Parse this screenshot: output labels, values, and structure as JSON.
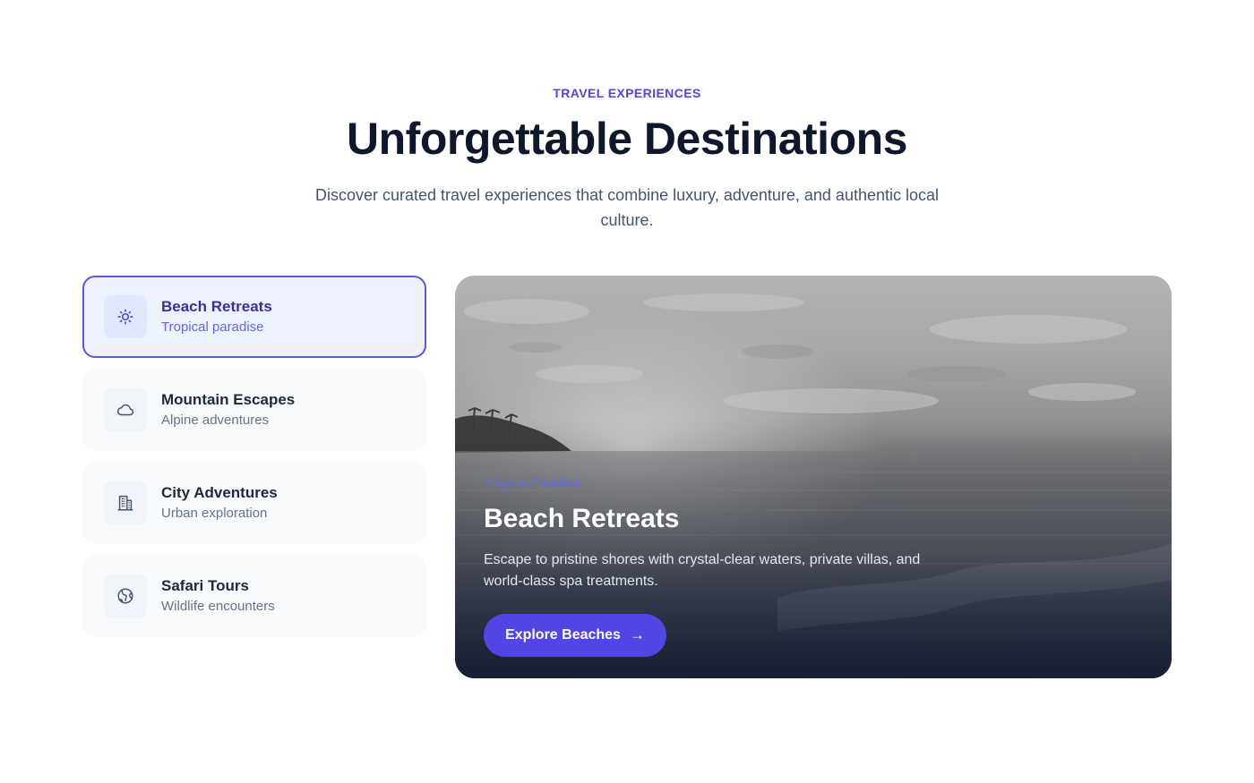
{
  "header": {
    "eyebrow": "TRAVEL EXPERIENCES",
    "title": "Unforgettable Destinations",
    "subtitle": "Discover curated travel experiences that combine luxury, adventure, and authentic local culture."
  },
  "tabs": [
    {
      "title": "Beach Retreats",
      "subtitle": "Tropical paradise",
      "icon": "sun-icon",
      "active": true
    },
    {
      "title": "Mountain Escapes",
      "subtitle": "Alpine adventures",
      "icon": "cloud-icon",
      "active": false
    },
    {
      "title": "City Adventures",
      "subtitle": "Urban exploration",
      "icon": "building-icon",
      "active": false
    },
    {
      "title": "Safari Tours",
      "subtitle": "Wildlife encounters",
      "icon": "globe-icon",
      "active": false
    }
  ],
  "feature": {
    "eyebrow": "Tropical Paradise",
    "title": "Beach Retreats",
    "description": "Escape to pristine shores with crystal-clear waters, private villas, and world-class spa treatments.",
    "cta_label": "Explore Beaches",
    "cta_arrow": "→"
  },
  "colors": {
    "accent": "#4f46e5",
    "active_border": "#5b5bd6",
    "heading": "#0f172a"
  }
}
